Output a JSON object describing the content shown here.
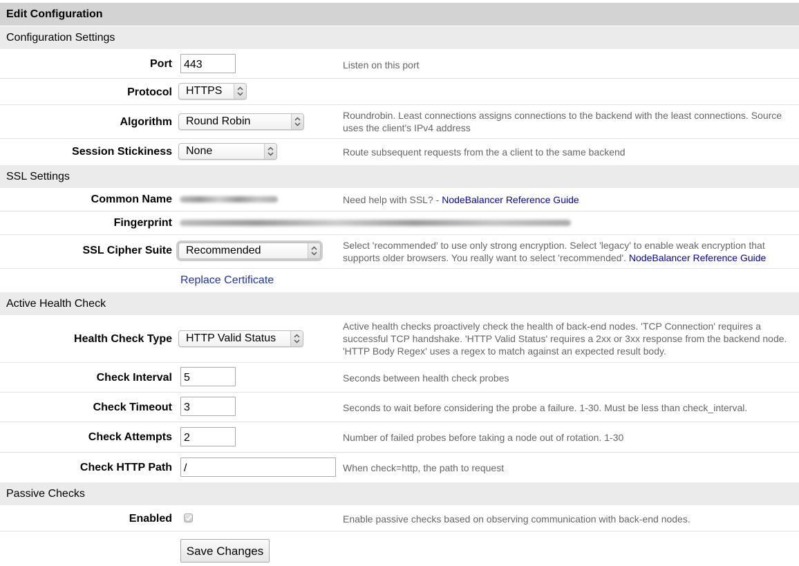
{
  "title": "Edit Configuration",
  "sections": {
    "config": "Configuration Settings",
    "ssl": "SSL Settings",
    "health": "Active Health Check",
    "passive": "Passive Checks"
  },
  "config": {
    "port": {
      "label": "Port",
      "value": "443",
      "help": "Listen on this port"
    },
    "protocol": {
      "label": "Protocol",
      "value": "HTTPS"
    },
    "algorithm": {
      "label": "Algorithm",
      "value": "Round Robin",
      "help": "Roundrobin. Least connections assigns connections to the backend with the least connections. Source uses the client's IPv4 address"
    },
    "stickiness": {
      "label": "Session Stickiness",
      "value": "None",
      "help": "Route subsequent requests from the a client to the same backend"
    }
  },
  "ssl": {
    "common_name": {
      "label": "Common Name",
      "help_prefix": "Need help with SSL? - ",
      "help_link": "NodeBalancer Reference Guide"
    },
    "fingerprint": {
      "label": "Fingerprint"
    },
    "cipher": {
      "label": "SSL Cipher Suite",
      "value": "Recommended",
      "help": "Select 'recommended' to use only strong encryption. Select 'legacy' to enable weak encryption that supports older browsers. You really want to select 'recommended'. ",
      "help_link": "NodeBalancer Reference Guide"
    },
    "replace_link": "Replace Certificate"
  },
  "health": {
    "type": {
      "label": "Health Check Type",
      "value": "HTTP Valid Status",
      "help": "Active health checks proactively check the health of back-end nodes. 'TCP Connection' requires a successful TCP handshake. 'HTTP Valid Status' requires a 2xx or 3xx response from the backend node. 'HTTP Body Regex' uses a regex to match against an expected result body."
    },
    "interval": {
      "label": "Check Interval",
      "value": "5",
      "help": "Seconds between health check probes"
    },
    "timeout": {
      "label": "Check Timeout",
      "value": "3",
      "help": "Seconds to wait before considering the probe a failure. 1-30. Must be less than check_interval."
    },
    "attempts": {
      "label": "Check Attempts",
      "value": "2",
      "help": "Number of failed probes before taking a node out of rotation. 1-30"
    },
    "path": {
      "label": "Check HTTP Path",
      "value": "/",
      "help": "When check=http, the path to request"
    }
  },
  "passive": {
    "enabled": {
      "label": "Enabled",
      "checked": true,
      "help": "Enable passive checks based on observing communication with back-end nodes."
    }
  },
  "save_label": "Save Changes"
}
